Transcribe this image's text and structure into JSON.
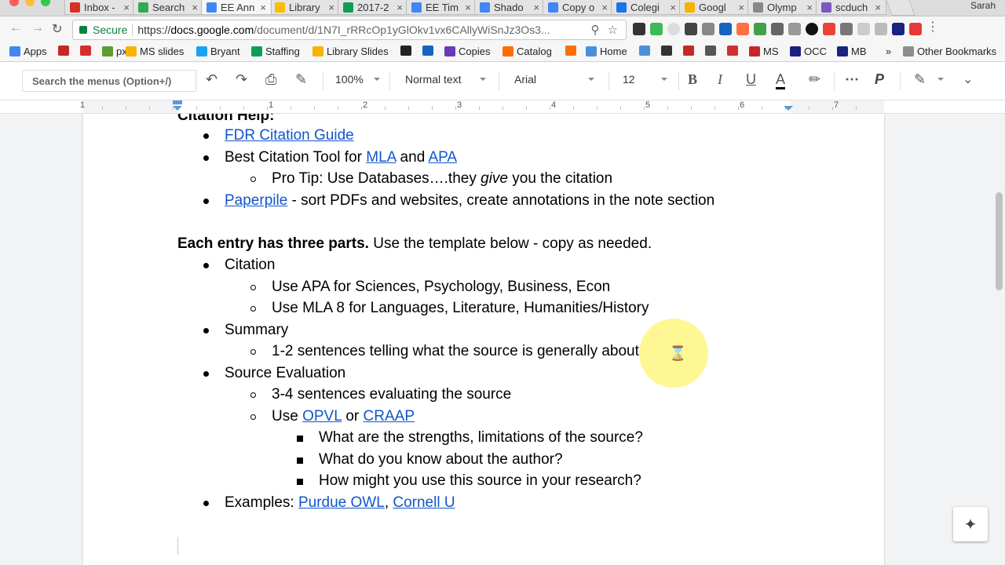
{
  "browser": {
    "tabs": [
      {
        "title": "Inbox -",
        "color": "#d93025",
        "icon": "gmail-icon"
      },
      {
        "title": "Search",
        "color": "#34a853",
        "icon": "drive-icon"
      },
      {
        "title": "EE Ann",
        "color": "#4285f4",
        "icon": "docs-icon",
        "active": true
      },
      {
        "title": "Library",
        "color": "#fbbc04",
        "icon": "slides-icon"
      },
      {
        "title": "2017-2",
        "color": "#0f9d58",
        "icon": "sheets-icon"
      },
      {
        "title": "EE Tim",
        "color": "#4285f4",
        "icon": "docs-icon"
      },
      {
        "title": "Shado",
        "color": "#4285f4",
        "icon": "docs-icon"
      },
      {
        "title": "Copy o",
        "color": "#4285f4",
        "icon": "docs-icon"
      },
      {
        "title": "Colegi",
        "color": "#1a73e8",
        "icon": "calendar-icon"
      },
      {
        "title": "Googl",
        "color": "#f4b400",
        "icon": "keep-icon"
      },
      {
        "title": "Olymp",
        "color": "#888888",
        "icon": "page-icon"
      },
      {
        "title": "scduch",
        "color": "#7e57c2",
        "icon": "mail-icon"
      }
    ],
    "profile_name": "Sarah",
    "secure_label": "Secure",
    "url_scheme": "https://",
    "url_domain": "docs.google.com",
    "url_path": "/document/d/1N7I_rRRcOp1yGlOkv1vx6CAllyWiSnJz3Os3..."
  },
  "bookmarks": {
    "items": [
      {
        "label": "Apps",
        "color": "#4285f4"
      },
      {
        "label": "",
        "color": "#c62828"
      },
      {
        "label": "",
        "color": "#d32f2f"
      },
      {
        "label": "px",
        "color": "#5c9e31"
      },
      {
        "label": "MS slides",
        "color": "#f4b400"
      },
      {
        "label": "Bryant",
        "color": "#1da1f2"
      },
      {
        "label": "Staffing",
        "color": "#0f9d58"
      },
      {
        "label": "Library Slides",
        "color": "#f4b400"
      },
      {
        "label": "",
        "color": "#222222"
      },
      {
        "label": "",
        "color": "#1565c0"
      },
      {
        "label": "Copies",
        "color": "#673ab7"
      },
      {
        "label": "Catalog",
        "color": "#ff6f00"
      },
      {
        "label": "",
        "color": "#ff6f00"
      },
      {
        "label": "Home",
        "color": "#4a90d9"
      },
      {
        "label": "",
        "color": "#4a90d9"
      },
      {
        "label": "",
        "color": "#333333"
      },
      {
        "label": "",
        "color": "#c62828"
      },
      {
        "label": "",
        "color": "#555555"
      },
      {
        "label": "",
        "color": "#d32f2f"
      },
      {
        "label": "MS",
        "color": "#c62828"
      },
      {
        "label": "OCC",
        "color": "#1a237e"
      },
      {
        "label": "MB",
        "color": "#1a237e"
      }
    ],
    "overflow": "»",
    "other_label": "Other Bookmarks"
  },
  "toolbar": {
    "search_placeholder": "Search the menus (Option+/)",
    "zoom": "100%",
    "style": "Normal text",
    "font": "Arial",
    "size": "12",
    "bold": "B",
    "italic": "I",
    "underline": "U",
    "text_color": "A"
  },
  "ruler": {
    "numbers": [
      "1",
      "1",
      "2",
      "3",
      "4",
      "5",
      "6",
      "7"
    ]
  },
  "doc": {
    "heading_citation": "Citation Help:",
    "fdr": "FDR Citation Guide",
    "best_tool": "Best Citation Tool for ",
    "mla": "MLA",
    "and": " and ",
    "apa": "APA",
    "pro_tip_a": "Pro Tip: Use Databases….they ",
    "pro_tip_give": "give",
    "pro_tip_b": " you the citation",
    "paperpile": "Paperpile",
    "paperpile_rest": " - sort PDFs and websites, create annotations in the note section",
    "entry_bold": "Each entry has three parts.",
    "entry_rest": " Use the template below - copy as needed.",
    "citation": "Citation",
    "use_apa": "Use APA for Sciences, Psychology, Business, Econ",
    "use_mla": "Use MLA 8 for Languages, Literature, Humanities/History",
    "summary": "Summary",
    "summary_detail": "1-2 sentences telling what the source is generally about",
    "source_eval": "Source Evaluation",
    "eval_detail": "3-4 sentences evaluating the source",
    "use": "Use ",
    "opvl": "OPVL",
    "or": " or ",
    "craap": "CRAAP",
    "q1": "What are the strengths, limitations of the source?",
    "q2": "What do you know about the author?",
    "q3": "How might you use this source in your research?",
    "examples": "Examples: ",
    "purdue": "Purdue OWL",
    "comma": ", ",
    "cornell": "Cornell U"
  }
}
